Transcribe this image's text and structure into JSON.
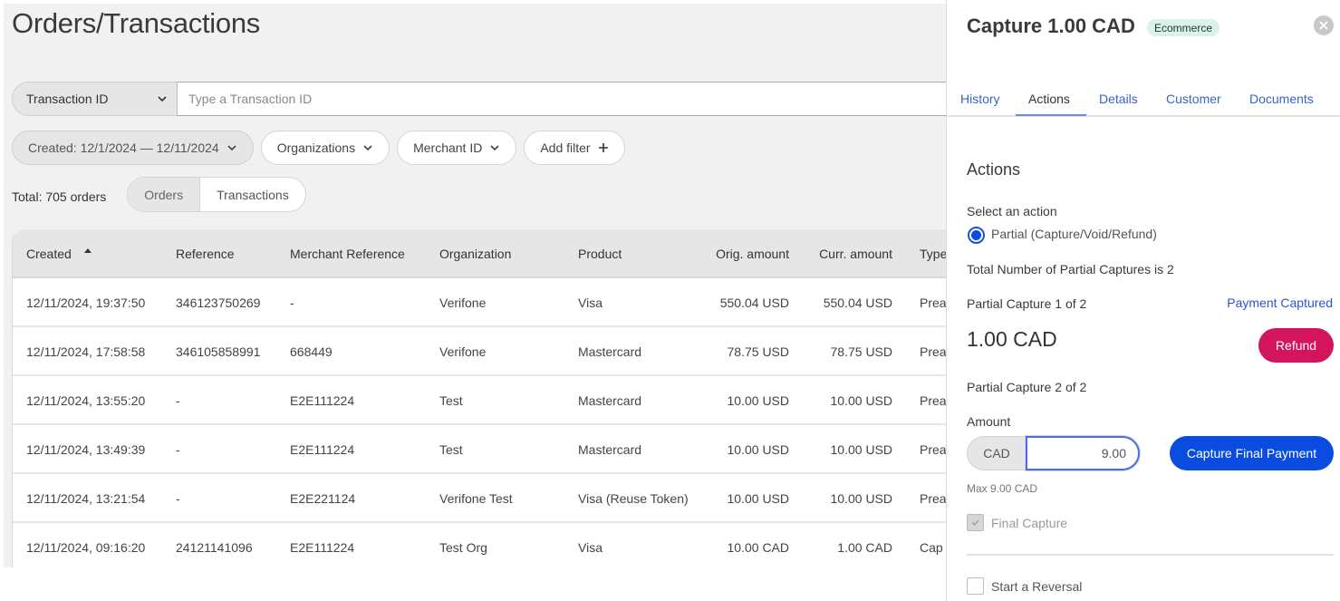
{
  "page": {
    "title": "Orders/Transactions",
    "search": {
      "field_selector": "Transaction ID",
      "placeholder": "Type a Transaction ID",
      "value": ""
    },
    "filters": [
      {
        "label": "Created: 12/1/2024 — 12/11/2024",
        "icon": "chevron-down-icon",
        "active": true
      },
      {
        "label": "Organizations",
        "icon": "chevron-down-icon",
        "active": false
      },
      {
        "label": "Merchant ID",
        "icon": "chevron-down-icon",
        "active": false
      },
      {
        "label": "Add filter",
        "icon": "plus-icon",
        "active": false
      }
    ],
    "total_label": "Total: 705 orders",
    "view_toggle": [
      {
        "label": "Orders",
        "active": true
      },
      {
        "label": "Transactions",
        "active": false
      }
    ]
  },
  "table": {
    "sort": {
      "column": "Created",
      "direction": "asc"
    },
    "columns": [
      "Created",
      "Reference",
      "Merchant Reference",
      "Organization",
      "Product",
      "Orig. amount",
      "Curr. amount",
      "Type"
    ],
    "rows": [
      [
        "12/11/2024, 19:37:50",
        "346123750269",
        "-",
        "Verifone",
        "Visa",
        "550.04 USD",
        "550.04 USD",
        "Prea"
      ],
      [
        "12/11/2024, 17:58:58",
        "346105858991",
        "668449",
        "Verifone",
        "Mastercard",
        "78.75 USD",
        "78.75 USD",
        "Prea"
      ],
      [
        "12/11/2024, 13:55:20",
        "-",
        "E2E111224",
        "Test",
        "Mastercard",
        "10.00 USD",
        "10.00 USD",
        "Prea"
      ],
      [
        "12/11/2024, 13:49:39",
        "-",
        "E2E111224",
        "Test",
        "Mastercard",
        "10.00 USD",
        "10.00 USD",
        "Prea"
      ],
      [
        "12/11/2024, 13:21:54",
        "-",
        "E2E221124",
        "Verifone Test",
        "Visa (Reuse Token)",
        "10.00 USD",
        "10.00 USD",
        "Prea"
      ],
      [
        "12/11/2024, 09:16:20",
        "24121141096",
        "E2E111224",
        "Test Org",
        "Visa",
        "10.00 CAD",
        "1.00 CAD",
        "Cap"
      ]
    ]
  },
  "panel": {
    "title": "Capture 1.00 CAD",
    "badge": "Ecommerce",
    "tabs": [
      {
        "label": "History",
        "active": false
      },
      {
        "label": "Actions",
        "active": true
      },
      {
        "label": "Details",
        "active": false
      },
      {
        "label": "Customer",
        "active": false
      },
      {
        "label": "Documents",
        "active": false
      }
    ],
    "section_title": "Actions",
    "select_action_label": "Select an action",
    "action_option": {
      "label": "Partial (Capture/Void/Refund)",
      "selected": true
    },
    "total_partial_label": "Total Number of Partial Captures is 2",
    "partial1": {
      "label": "Partial Capture 1 of 2",
      "status": "Payment Captured",
      "amount": "1.00 CAD",
      "button": "Refund"
    },
    "partial2": {
      "label": "Partial Capture 2 of 2",
      "amount_label": "Amount",
      "currency": "CAD",
      "amount_value": "9.00",
      "max_hint": "Max 9.00 CAD",
      "button": "Capture Final Payment",
      "final_capture": {
        "label": "Final Capture",
        "checked": true,
        "disabled": true
      }
    },
    "reversal": {
      "label": "Start a Reversal",
      "checked": false
    }
  },
  "colors": {
    "primary": "#0a4be0",
    "refund": "#d4155e",
    "link": "#2b55cf",
    "badge_bg": "#d7f3ea"
  }
}
